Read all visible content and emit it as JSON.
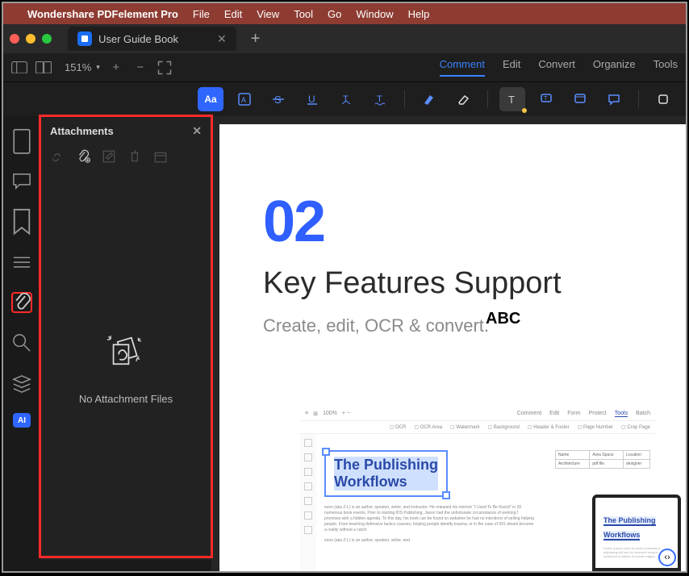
{
  "menubar": {
    "app": "Wondershare PDFelement Pro",
    "items": [
      "File",
      "Edit",
      "View",
      "Tool",
      "Go",
      "Window",
      "Help"
    ]
  },
  "tab": {
    "title": "User Guide Book"
  },
  "controls": {
    "zoom": "151%",
    "tabs": [
      "Comment",
      "Edit",
      "Convert",
      "Organize",
      "Tools"
    ],
    "activeTab": "Comment"
  },
  "panel": {
    "title": "Attachments",
    "empty": "No Attachment Files"
  },
  "rail": {
    "ai": "AI"
  },
  "page": {
    "number": "02",
    "abc": "ABC",
    "title": "Key Features Support",
    "subtitle": "Create, edit, OCR & convert."
  },
  "mini": {
    "toolbar": [
      "Comment",
      "Edit",
      "Form",
      "Protect",
      "Tools",
      "Batch"
    ],
    "opts": [
      "OCR",
      "OCR Area",
      "Watermark",
      "Background",
      "Header & Footer",
      "Page Number",
      "Crop Page"
    ],
    "box_l1": "The Publishing",
    "box_l2": "Workflows",
    "para": "eson (aka Z-L) is an author, speaker, writer, and instructor. He released his memoir \"I Used To Be Racist\" in 20 numerous book events. Prior to starting IDS Publishing, Jason had the unfortunate circumstance of working f promises with a hidden agenda. To this day, his book can be found on websites he had no intentions of selling helping people. From teaching defensive tactics courses, helping people identify trauma, or in the case of IDS dream become a reality without a catch.",
    "para2": "eson (aka Z-L) is an author, speaker, writer, and",
    "table": [
      [
        "Name",
        "Area Space",
        "Location"
      ],
      [
        "Architecture",
        "pdf file",
        "designer"
      ]
    ],
    "tablet_l1": "The Publishing",
    "tablet_l2": "Workflows"
  }
}
